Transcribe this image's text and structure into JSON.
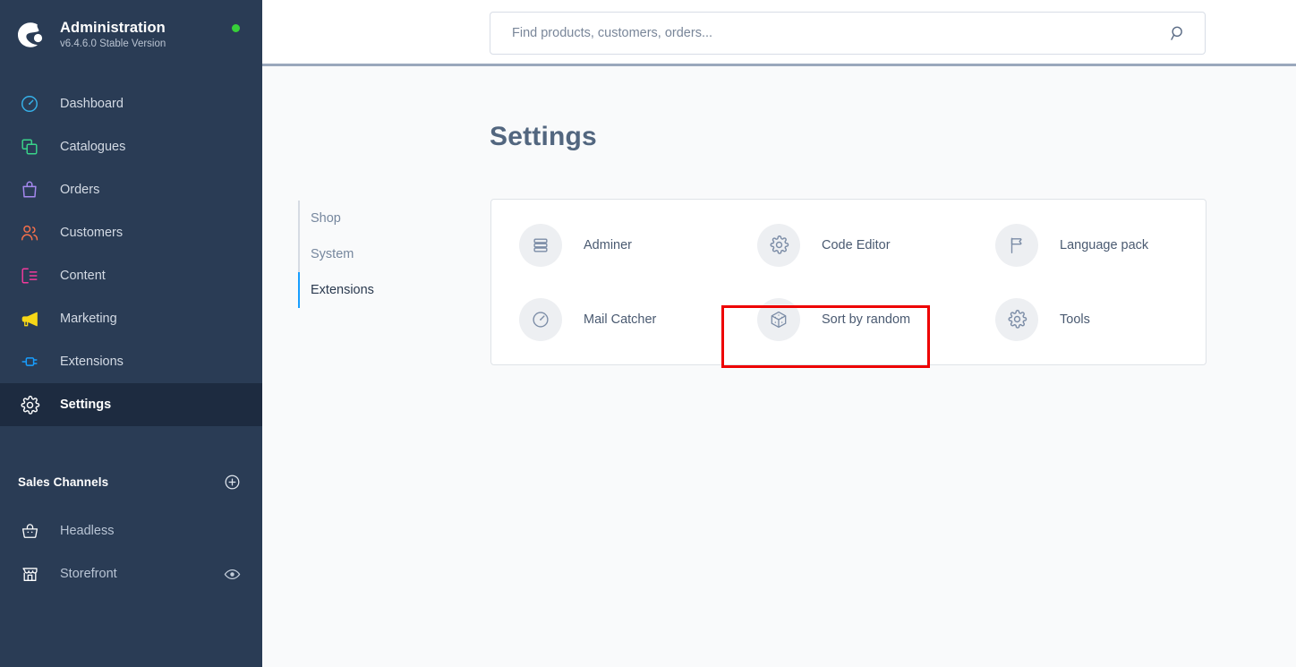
{
  "sidebar": {
    "brand": {
      "logo_icon": "shopware-logo-icon",
      "title": "Administration",
      "version": "v6.4.6.0 Stable Version",
      "status_dot_color": "#37d039"
    },
    "nav_items": [
      {
        "label": "Dashboard",
        "icon": "speedometer-icon",
        "color": "#36b1e9",
        "active": false
      },
      {
        "label": "Catalogues",
        "icon": "copy-icon",
        "color": "#39d38a",
        "active": false
      },
      {
        "label": "Orders",
        "icon": "bag-icon",
        "color": "#a689f0",
        "active": false
      },
      {
        "label": "Customers",
        "icon": "users-icon",
        "color": "#f7704a",
        "active": false
      },
      {
        "label": "Content",
        "icon": "content-icon",
        "color": "#f23a9c",
        "active": false
      },
      {
        "label": "Marketing",
        "icon": "megaphone-icon",
        "color": "#f6d717",
        "active": false
      },
      {
        "label": "Extensions",
        "icon": "plug-icon",
        "color": "#189eff",
        "active": false
      },
      {
        "label": "Settings",
        "icon": "gear-icon",
        "color": "#ffffff",
        "active": true
      }
    ],
    "sales_channels": {
      "title": "Sales Channels",
      "add_icon": "plus-circle-icon",
      "items": [
        {
          "label": "Headless",
          "icon": "basket-icon",
          "has_preview": false,
          "preview_icon": ""
        },
        {
          "label": "Storefront",
          "icon": "storefront-icon",
          "has_preview": true,
          "preview_icon": "eye-icon"
        }
      ]
    }
  },
  "topbar": {
    "search": {
      "placeholder": "Find products, customers, orders...",
      "value": "",
      "icon": "search-icon"
    }
  },
  "page": {
    "title": "Settings",
    "tabs": [
      {
        "label": "Shop",
        "active": false
      },
      {
        "label": "System",
        "active": false
      },
      {
        "label": "Extensions",
        "active": true
      }
    ],
    "active_tab_indicator_color": "#189eff"
  },
  "extensions_card": {
    "items": [
      {
        "label": "Adminer",
        "icon": "database-icon",
        "highlighted": false
      },
      {
        "label": "Code Editor",
        "icon": "gear-icon",
        "highlighted": false
      },
      {
        "label": "Language pack",
        "icon": "flag-icon",
        "highlighted": false
      },
      {
        "label": "Mail Catcher",
        "icon": "speedometer-icon",
        "highlighted": false
      },
      {
        "label": "Sort by random",
        "icon": "dice-cube-icon",
        "highlighted": true
      },
      {
        "label": "Tools",
        "icon": "gear-icon",
        "highlighted": false
      }
    ]
  },
  "highlight": {
    "target": "Sort by random",
    "color": "#ee0000"
  }
}
